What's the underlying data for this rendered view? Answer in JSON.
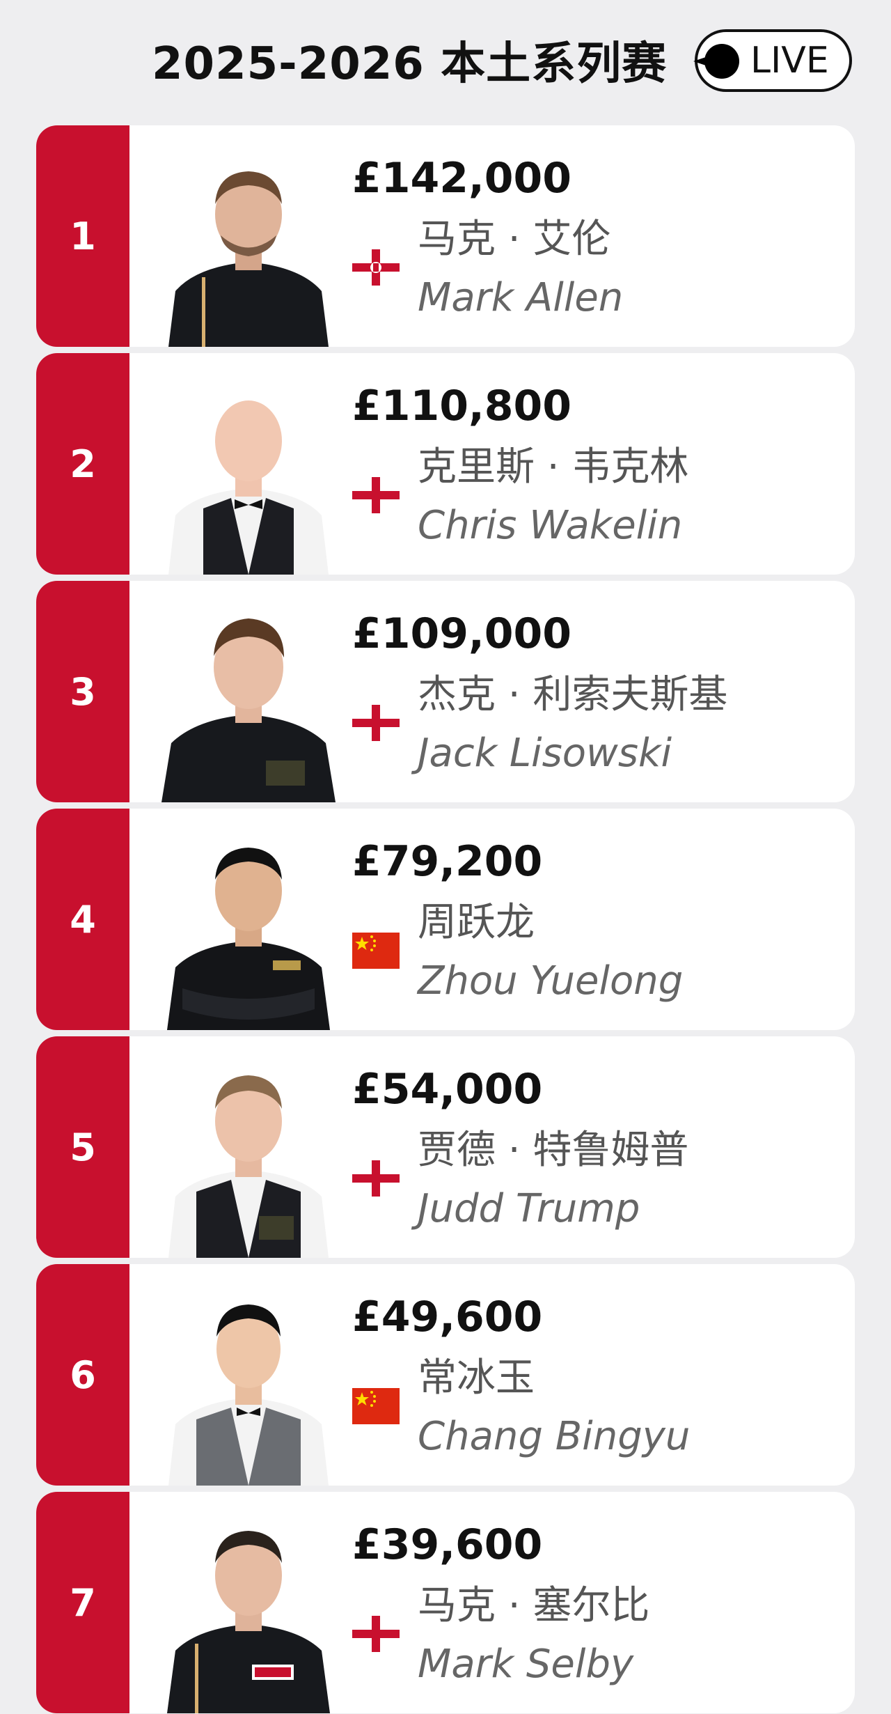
{
  "header": {
    "title": "2025-2026 本土系列赛",
    "live_label": "LIVE"
  },
  "colors": {
    "accent": "#c8102e",
    "background": "#eeeef0",
    "card": "#ffffff"
  },
  "rankings": [
    {
      "rank": "1",
      "prize": "£142,000",
      "name_cn": "马克 · 艾伦",
      "name_en": "Mark Allen",
      "flag": "northern-ireland-flag-icon"
    },
    {
      "rank": "2",
      "prize": "£110,800",
      "name_cn": "克里斯 · 韦克林",
      "name_en": "Chris Wakelin",
      "flag": "england-flag-icon"
    },
    {
      "rank": "3",
      "prize": "£109,000",
      "name_cn": "杰克 · 利索夫斯基",
      "name_en": "Jack Lisowski",
      "flag": "england-flag-icon"
    },
    {
      "rank": "4",
      "prize": "£79,200",
      "name_cn": "周跃龙",
      "name_en": "Zhou Yuelong",
      "flag": "china-flag-icon"
    },
    {
      "rank": "5",
      "prize": "£54,000",
      "name_cn": "贾德 · 特鲁姆普",
      "name_en": "Judd Trump",
      "flag": "england-flag-icon"
    },
    {
      "rank": "6",
      "prize": "£49,600",
      "name_cn": "常冰玉",
      "name_en": "Chang Bingyu",
      "flag": "china-flag-icon"
    },
    {
      "rank": "7",
      "prize": "£39,600",
      "name_cn": "马克 · 塞尔比",
      "name_en": "Mark Selby",
      "flag": "england-flag-icon"
    }
  ]
}
